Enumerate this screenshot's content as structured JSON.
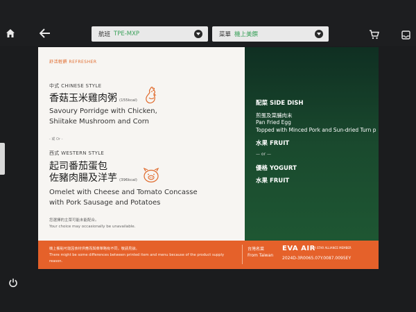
{
  "nav": {
    "flight_label": "航班",
    "flight_value": "TPE-MXP",
    "menu_label": "菜單",
    "menu_value": "機上美饌"
  },
  "menu": {
    "section_tag": "舒活輕饌 REFRESHER",
    "option1": {
      "category": "中式 CHINESE STYLE",
      "title_zh": "香菇玉米雞肉粥",
      "kcal": "(155kcal)",
      "desc_en_1": "Savoury Porridge with Chicken,",
      "desc_en_2": "Shiitake Mushroom and Corn"
    },
    "or_text": "- 或 Or -",
    "option2": {
      "category": "西式 WESTERN STYLE",
      "title_zh_1": "起司番茄蛋包",
      "title_zh_2": "佐豬肉腸及洋芋",
      "kcal": "(396kcal)",
      "desc_en_1": "Omelet with Cheese and Tomato Concasse",
      "desc_en_2": "with Pork Sausage and Potatoes"
    },
    "availability_zh": "您選擇的主菜可能未能配合。",
    "availability_en": "Your choice may occasionally be unavailable.",
    "side_dish_head": "配菜  SIDE DISH",
    "side_dish_zh": "煎蛋及菜脯肉末",
    "side_dish_en_1": "Pan Fried Egg",
    "side_dish_en_2": "Topped with Minced Pork and Sun-dried Turn p",
    "fruit_head_1": "水果  FRUIT",
    "or_small": "— or —",
    "yogurt_head": "優格  YOGURT",
    "fruit_head_2": "水果  FRUIT",
    "footer_notice_zh": "機上餐點可能因食材供應而與菜單略有不同，敬請見諒。",
    "footer_notice_en": "There might be some differences between printed item and menu because of the product supply reason.",
    "origin_zh": "台灣名菜",
    "origin_en": "From Taiwan",
    "brand": "EVA AIR",
    "alliance": "A STAR ALLIANCE MEMBER",
    "code": "2024D-3R0065.07Y.0087.0095EY"
  },
  "colors": {
    "accent_orange": "#e5612a",
    "green_panel": "#1a5432",
    "value_green": "#3aa15a"
  }
}
